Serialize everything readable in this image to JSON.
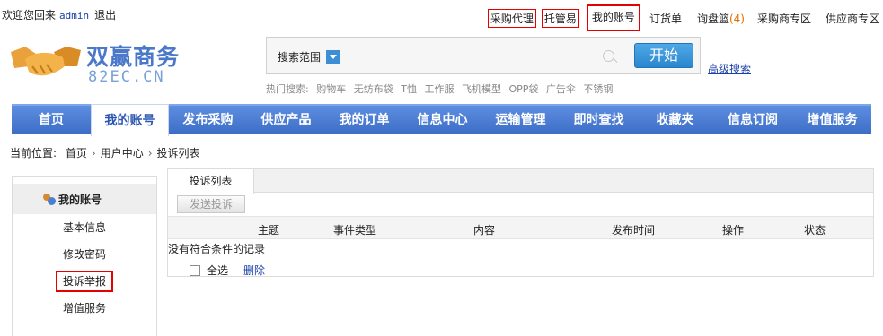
{
  "topbar": {
    "welcome": "欢迎您回来",
    "user": "admin",
    "logout": "退出",
    "links": [
      "采购代理",
      "托管易",
      "我的账号",
      "订货单",
      "询盘篮",
      "采购商专区",
      "供应商专区"
    ],
    "inquiry_count": "(4)"
  },
  "logo": {
    "cn": "双赢商务",
    "en": "82EC.CN"
  },
  "search": {
    "scope_label": "搜索范围",
    "button": "开始",
    "advanced": "高级搜索",
    "hot_label": "热门搜索:",
    "hot_terms": [
      "购物车",
      "无纺布袋",
      "T恤",
      "工作服",
      "飞机模型",
      "OPP袋",
      "广告伞",
      "不锈钢"
    ]
  },
  "nav": [
    "首页",
    "我的账号",
    "发布采购",
    "供应产品",
    "我的订单",
    "信息中心",
    "运输管理",
    "即时查找",
    "收藏夹",
    "信息订阅",
    "增值服务"
  ],
  "breadcrumb": {
    "label": "当前位置:",
    "items": [
      "首页",
      "用户中心",
      "投诉列表"
    ]
  },
  "sidebar": {
    "title": "我的账号",
    "items": [
      "基本信息",
      "修改密码",
      "投诉举报",
      "增值服务"
    ]
  },
  "main": {
    "tab": "投诉列表",
    "send_button": "发送投诉",
    "columns": [
      "主题",
      "事件类型",
      "内容",
      "发布时间",
      "操作",
      "状态"
    ],
    "empty_text": "没有符合条件的记录",
    "select_all": "全选",
    "delete": "删除"
  },
  "colors": {
    "nav": "#4a7cd3",
    "link": "#1a3fa8",
    "highlight": "#e60000"
  }
}
